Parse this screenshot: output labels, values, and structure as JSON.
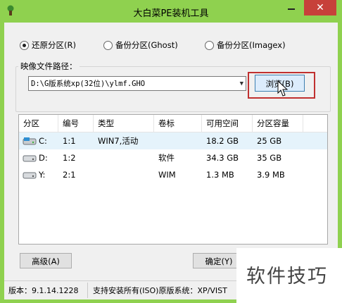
{
  "window": {
    "title": "大白菜PE装机工具",
    "close_glyph": "✕",
    "accent_color": "#8fd14f",
    "close_color": "#c7413a"
  },
  "radios": [
    {
      "label": "还原分区(R)",
      "checked": true
    },
    {
      "label": "备份分区(Ghost)",
      "checked": false
    },
    {
      "label": "备份分区(Imagex)",
      "checked": false
    }
  ],
  "image_path": {
    "label": "映像文件路径：",
    "value": "D:\\G版系统xp(32位)\\ylmf.GHO",
    "browse_label": "浏览(B)"
  },
  "table": {
    "columns": [
      "分区",
      "编号",
      "类型",
      "卷标",
      "可用空间",
      "分区容量"
    ],
    "rows": [
      {
        "partition": "C:",
        "number": "1:1",
        "type": "WIN7,活动",
        "label": "",
        "free": "18.2 GB",
        "capacity": "25 GB",
        "selected": true,
        "icon": "system-disk-icon"
      },
      {
        "partition": "D:",
        "number": "1:2",
        "type": "",
        "label": "软件",
        "free": "34.3 GB",
        "capacity": "35 GB",
        "selected": false,
        "icon": "disk-icon"
      },
      {
        "partition": "Y:",
        "number": "2:1",
        "type": "",
        "label": "WIM",
        "free": "1.3 MB",
        "capacity": "3.9 MB",
        "selected": false,
        "icon": "disk-icon"
      }
    ]
  },
  "buttons": {
    "advanced": "高级(A)",
    "ok": "确定(Y)"
  },
  "status": {
    "version": "版本：9.1.14.1228",
    "support": "支持安装所有(ISO)原版系统：XP/VIST"
  },
  "watermark": "软件技巧"
}
